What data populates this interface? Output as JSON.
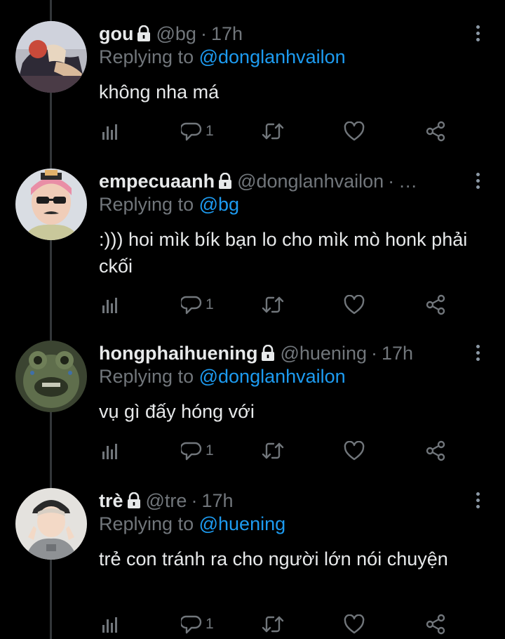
{
  "tweets": [
    {
      "name": "gou",
      "handle": "@bg",
      "time": "17h",
      "reply_prefix": "Replying to",
      "reply_to": "@donglanhvailon",
      "text": "không nha má",
      "reply_count": "1",
      "avatar": "anime-character-avatar"
    },
    {
      "name": "empecuaanh",
      "handle": "@donglanhvailon",
      "time": "…",
      "reply_prefix": "Replying to",
      "reply_to": "@bg",
      "text": ":))) hoi mìk bík bạn lo cho mìk mò honk phải ckối",
      "reply_count": "1",
      "avatar": "person-with-sunglasses-avatar"
    },
    {
      "name": "hongphaihuening",
      "handle": "@huening",
      "time": "17h",
      "reply_prefix": "Replying to",
      "reply_to": "@donglanhvailon",
      "text": "vụ gì đấy hóng với",
      "reply_count": "1",
      "avatar": "green-creature-avatar"
    },
    {
      "name": "trè",
      "handle": "@tre",
      "time": "17h",
      "reply_prefix": "Replying to",
      "reply_to": "@huening",
      "text": "trẻ con tránh ra cho người lớn nói chuyện",
      "reply_count": "1",
      "avatar": "person-in-cap-avatar"
    }
  ],
  "icons": {
    "protected": "lock-icon",
    "more": "more-vertical-icon",
    "analytics": "analytics-icon",
    "reply": "reply-icon",
    "retweet": "retweet-icon",
    "like": "heart-icon",
    "share": "share-icon"
  },
  "colors": {
    "background": "#000000",
    "text": "#e7e9ea",
    "secondary": "#71767b",
    "link": "#1d9bf0",
    "thread_line": "#333639"
  }
}
